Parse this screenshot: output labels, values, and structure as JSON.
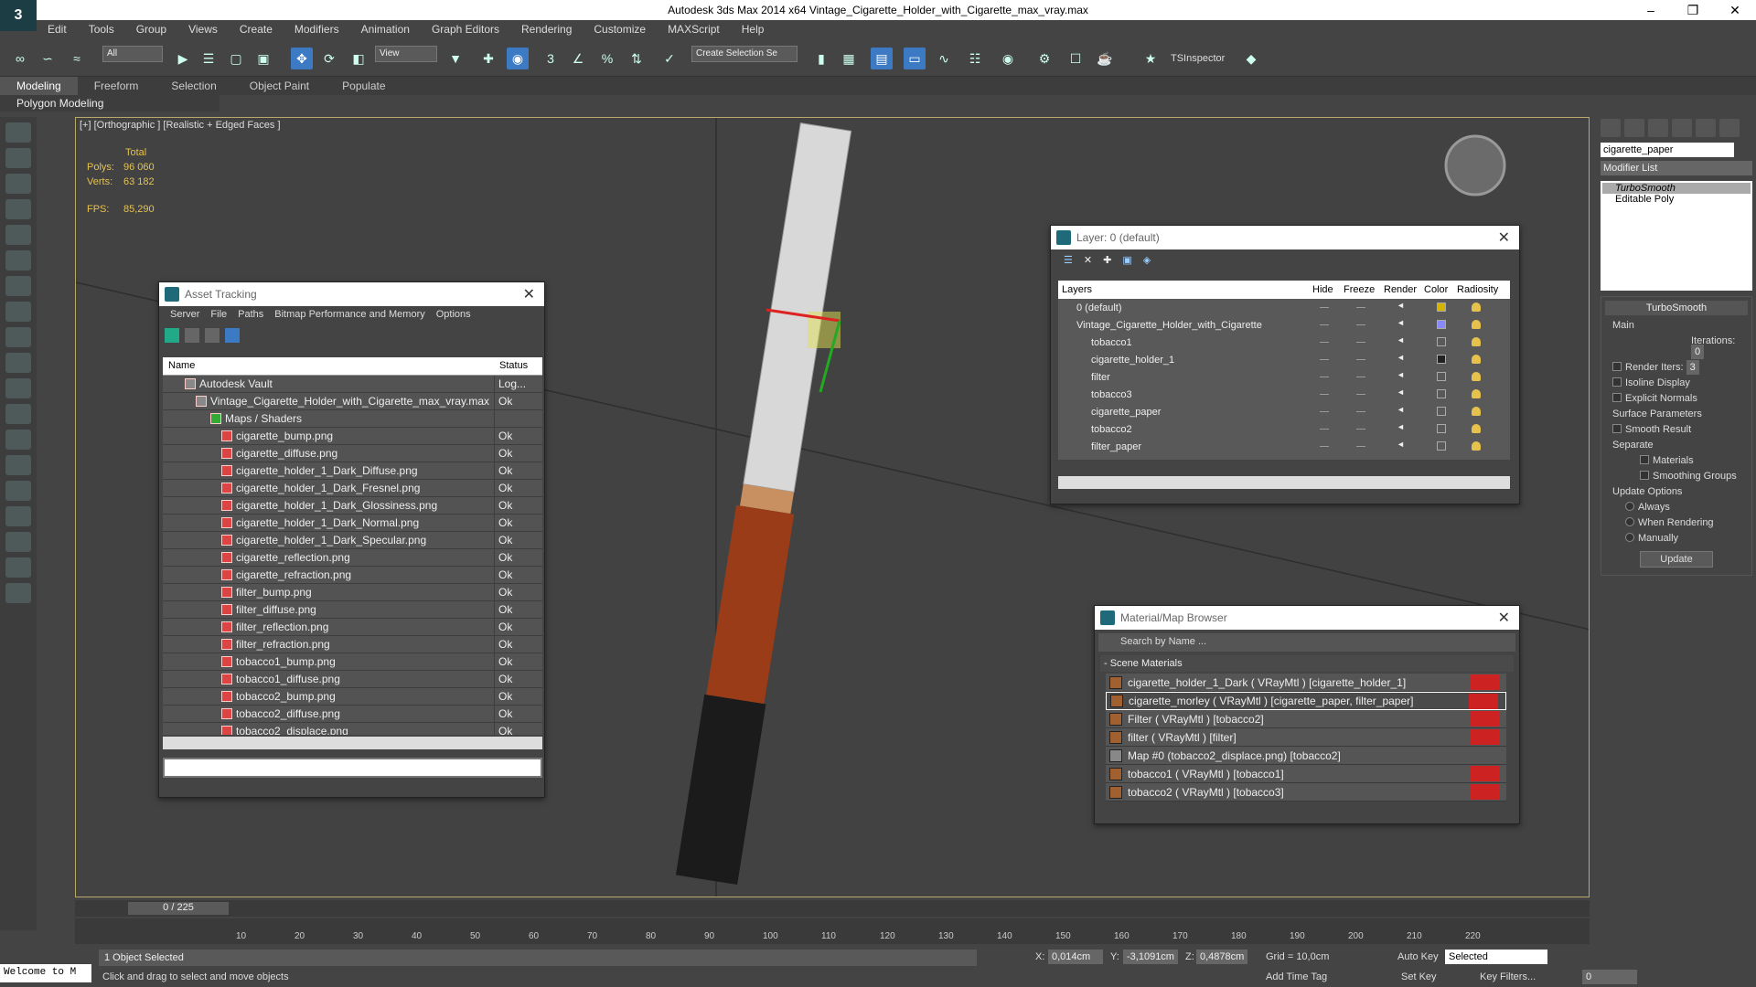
{
  "app": {
    "title": "Autodesk 3ds Max  2014 x64    Vintage_Cigarette_Holder_with_Cigarette_max_vray.max",
    "logo": "3"
  },
  "menu": [
    "Edit",
    "Tools",
    "Group",
    "Views",
    "Create",
    "Modifiers",
    "Animation",
    "Graph Editors",
    "Rendering",
    "Customize",
    "MAXScript",
    "Help"
  ],
  "toolbar": {
    "filter_select": "All",
    "ref_coord": "View",
    "selection_set": "Create Selection Se",
    "tsinspector": "TSInspector"
  },
  "ribbon": {
    "tabs": [
      "Modeling",
      "Freeform",
      "Selection",
      "Object Paint",
      "Populate"
    ],
    "panel": "Polygon Modeling"
  },
  "viewport": {
    "label": "[+] [Orthographic ] [Realistic + Edged Faces ]",
    "stats": {
      "total_label": "Total",
      "polys_label": "Polys:",
      "polys": "96 060",
      "verts_label": "Verts:",
      "verts": "63 182",
      "fps_label": "FPS:",
      "fps": "85,290"
    }
  },
  "asset_tracking": {
    "title": "Asset Tracking",
    "menu": [
      "Server",
      "File",
      "Paths",
      "Bitmap Performance and Memory",
      "Options"
    ],
    "col_name": "Name",
    "col_status": "Status",
    "rows": [
      {
        "name": "Autodesk Vault",
        "status": "Log..."
      },
      {
        "name": "Vintage_Cigarette_Holder_with_Cigarette_max_vray.max",
        "status": "Ok"
      },
      {
        "name": "Maps / Shaders",
        "status": ""
      },
      {
        "name": "cigarette_bump.png",
        "status": "Ok"
      },
      {
        "name": "cigarette_diffuse.png",
        "status": "Ok"
      },
      {
        "name": "cigarette_holder_1_Dark_Diffuse.png",
        "status": "Ok"
      },
      {
        "name": "cigarette_holder_1_Dark_Fresnel.png",
        "status": "Ok"
      },
      {
        "name": "cigarette_holder_1_Dark_Glossiness.png",
        "status": "Ok"
      },
      {
        "name": "cigarette_holder_1_Dark_Normal.png",
        "status": "Ok"
      },
      {
        "name": "cigarette_holder_1_Dark_Specular.png",
        "status": "Ok"
      },
      {
        "name": "cigarette_reflection.png",
        "status": "Ok"
      },
      {
        "name": "cigarette_refraction.png",
        "status": "Ok"
      },
      {
        "name": "filter_bump.png",
        "status": "Ok"
      },
      {
        "name": "filter_diffuse.png",
        "status": "Ok"
      },
      {
        "name": "filter_reflection.png",
        "status": "Ok"
      },
      {
        "name": "filter_refraction.png",
        "status": "Ok"
      },
      {
        "name": "tobacco1_bump.png",
        "status": "Ok"
      },
      {
        "name": "tobacco1_diffuse.png",
        "status": "Ok"
      },
      {
        "name": "tobacco2_bump.png",
        "status": "Ok"
      },
      {
        "name": "tobacco2_diffuse.png",
        "status": "Ok"
      },
      {
        "name": "tobacco2_displace.png",
        "status": "Ok"
      }
    ]
  },
  "layer_window": {
    "title": "Layer: 0 (default)",
    "cols": [
      "Layers",
      "Hide",
      "Freeze",
      "Render",
      "Color",
      "Radiosity"
    ],
    "rows": [
      {
        "name": "0 (default)",
        "color": "#d4b400"
      },
      {
        "name": "Vintage_Cigarette_Holder_with_Cigarette",
        "color": "#8888ff"
      },
      {
        "name": "tobacco1",
        "color": "#595959"
      },
      {
        "name": "cigarette_holder_1",
        "color": "#222222"
      },
      {
        "name": "filter",
        "color": "#595959"
      },
      {
        "name": "tobacco3",
        "color": "#595959"
      },
      {
        "name": "cigarette_paper",
        "color": "#595959"
      },
      {
        "name": "tobacco2",
        "color": "#595959"
      },
      {
        "name": "filter_paper",
        "color": "#595959"
      }
    ]
  },
  "material_browser": {
    "title": "Material/Map Browser",
    "search_placeholder": "Search by Name ...",
    "group": "- Scene Materials",
    "rows": [
      {
        "name": "cigarette_holder_1_Dark  ( VRayMtl ) [cigarette_holder_1]",
        "selected": false
      },
      {
        "name": "cigarette_morley  ( VRayMtl ) [cigarette_paper, filter_paper]",
        "selected": true
      },
      {
        "name": "Filter  ( VRayMtl ) [tobacco2]",
        "selected": false
      },
      {
        "name": "filter  ( VRayMtl ) [filter]",
        "selected": false
      },
      {
        "name": "Map #0 (tobacco2_displace.png) [tobacco2]",
        "selected": false
      },
      {
        "name": "tobacco1  ( VRayMtl ) [tobacco1]",
        "selected": false
      },
      {
        "name": "tobacco2  ( VRayMtl ) [tobacco3]",
        "selected": false
      }
    ]
  },
  "command_panel": {
    "object_name": "cigarette_paper",
    "modifier_list": "Modifier List",
    "stack": [
      "TurboSmooth",
      "Editable Poly"
    ],
    "turbosmooth": {
      "title": "TurboSmooth",
      "main": "Main",
      "iterations_label": "Iterations:",
      "iterations": "0",
      "render_iters_label": "Render Iters:",
      "render_iters": "3",
      "isoline": "Isoline Display",
      "explicit_normals": "Explicit Normals",
      "surface_params": "Surface Parameters",
      "smooth_result": "Smooth Result",
      "separate": "Separate",
      "materials": "Materials",
      "smoothing_groups": "Smoothing Groups",
      "update_options": "Update Options",
      "always": "Always",
      "when_rendering": "When Rendering",
      "manually": "Manually",
      "update_btn": "Update"
    }
  },
  "timeline": {
    "frame": "0 / 225",
    "ticks": [
      "10",
      "20",
      "30",
      "40",
      "50",
      "60",
      "70",
      "80",
      "90",
      "100",
      "110",
      "120",
      "130",
      "140",
      "150",
      "160",
      "170",
      "180",
      "190",
      "200",
      "210",
      "220"
    ]
  },
  "status": {
    "welcome": "Welcome to M",
    "selected": "1 Object Selected",
    "prompt": "Click and drag to select and move objects",
    "x_label": "X:",
    "x": "0,014cm",
    "y_label": "Y:",
    "y": "-3,1091cm",
    "z_label": "Z:",
    "z": "0,4878cm",
    "grid": "Grid = 10,0cm",
    "add_time_tag": "Add Time Tag",
    "auto_key": "Auto Key",
    "set_key": "Set Key",
    "selected_dd": "Selected",
    "key_filters": "Key Filters...",
    "frame_field": "0"
  }
}
